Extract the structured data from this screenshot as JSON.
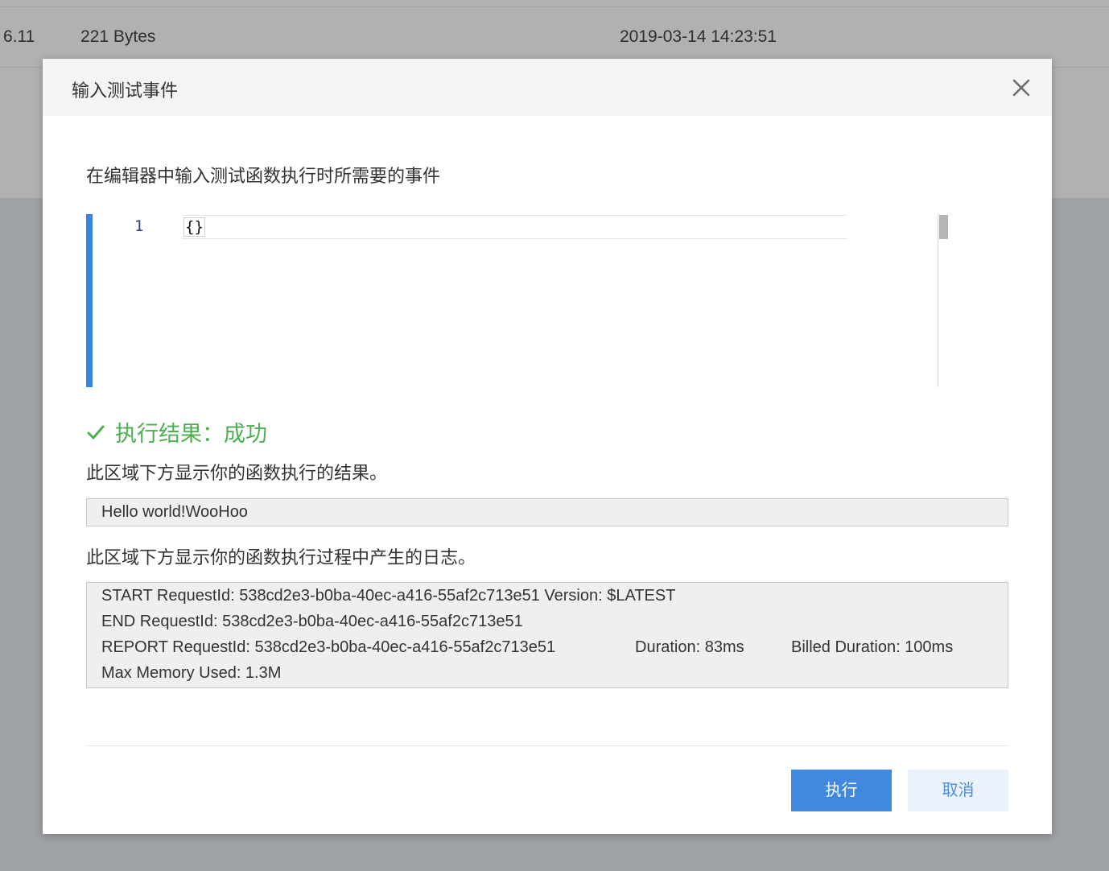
{
  "background_row": {
    "col1": "6.11",
    "col2": "221 Bytes",
    "col3": "2019-03-14 14:23:51"
  },
  "modal": {
    "title": "输入测试事件",
    "description": "在编辑器中输入测试函数执行时所需要的事件",
    "editor": {
      "line_number": "1",
      "code": "{}"
    },
    "result": {
      "status": "执行结果：成功",
      "status_color": "#4caf50",
      "output_note": "此区域下方显示你的函数执行的结果。",
      "output": "Hello world!WooHoo",
      "log_note": "此区域下方显示你的函数执行过程中产生的日志。",
      "log_lines": [
        "START RequestId: 538cd2e3-b0ba-40ec-a416-55af2c713e51 Version: $LATEST",
        "END RequestId: 538cd2e3-b0ba-40ec-a416-55af2c713e51",
        "REPORT RequestId: 538cd2e3-b0ba-40ec-a416-55af2c713e51",
        "Max Memory Used: 1.3M"
      ],
      "log_duration": "Duration: 83ms",
      "log_billed": "Billed Duration: 100ms"
    },
    "buttons": {
      "run_label": "执行",
      "cancel_label": "取消",
      "run_color": "#4089df"
    }
  }
}
